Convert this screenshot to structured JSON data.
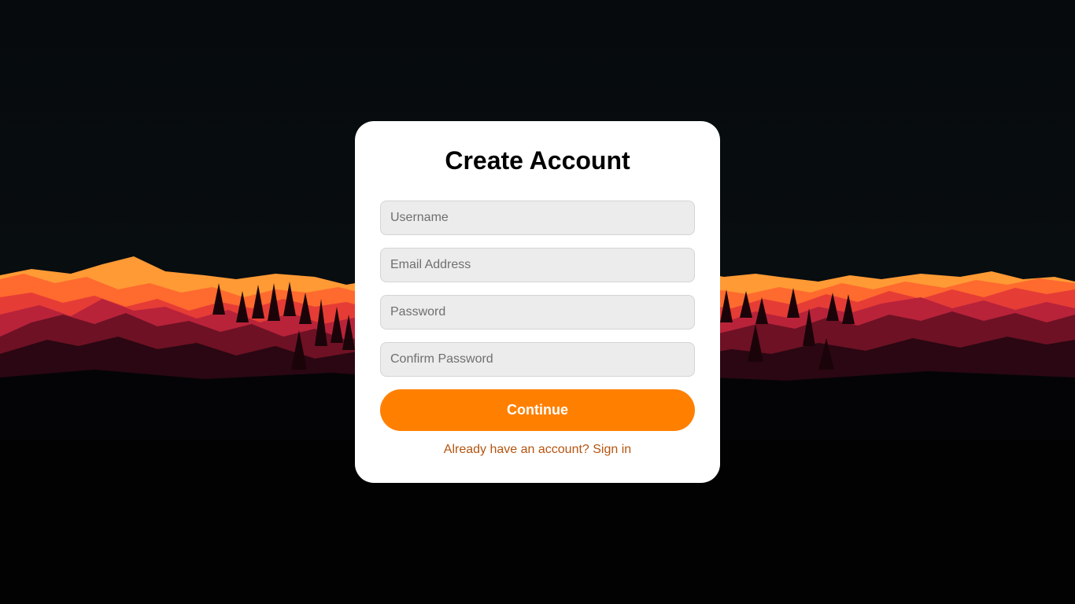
{
  "background": {
    "sky_color": "#05080a",
    "ground_color": "#020203",
    "mountain_colors": [
      "#ff9a35",
      "#ff6a2e",
      "#e63c36",
      "#b8233a",
      "#6e1124",
      "#2a0712"
    ]
  },
  "form": {
    "title": "Create Account",
    "fields": {
      "username_placeholder": "Username",
      "email_placeholder": "Email Address",
      "password_placeholder": "Password",
      "confirm_password_placeholder": "Confirm Password"
    },
    "continue_label": "Continue",
    "signin_link_label": "Already have an account? Sign in",
    "accent_color": "#ff8000",
    "link_color": "#b5540f"
  }
}
